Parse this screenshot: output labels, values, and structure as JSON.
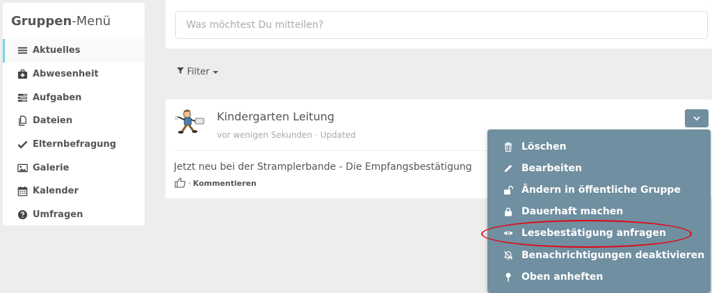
{
  "sidebar": {
    "title_bold": "Gruppen",
    "title_rest": "-Menü",
    "items": [
      {
        "label": "Aktuelles",
        "icon": "list-icon"
      },
      {
        "label": "Abwesenheit",
        "icon": "medkit-icon"
      },
      {
        "label": "Aufgaben",
        "icon": "tasks-icon"
      },
      {
        "label": "Dateien",
        "icon": "files-icon"
      },
      {
        "label": "Elternbefragung",
        "icon": "check-icon"
      },
      {
        "label": "Galerie",
        "icon": "image-icon"
      },
      {
        "label": "Kalender",
        "icon": "calendar-icon"
      },
      {
        "label": "Umfragen",
        "icon": "question-circle-icon"
      }
    ]
  },
  "post": {
    "placeholder": "Was möchtest Du mitteilen?"
  },
  "filter": {
    "label": "Filter"
  },
  "entry": {
    "author": "Kindergarten Leitung",
    "meta": "vor wenigen Sekunden · Updated",
    "text": "Jetzt neu bei der Stramplerbande - Die Empfangsbestätigung",
    "actions_separator": "·",
    "comment_label": "Kommentieren"
  },
  "dropdown": {
    "items": [
      {
        "label": "Löschen",
        "icon": "trash-icon"
      },
      {
        "label": "Bearbeiten",
        "icon": "pencil-icon"
      },
      {
        "label": "Ändern in öffentliche Gruppe",
        "icon": "unlock-icon"
      },
      {
        "label": "Dauerhaft machen",
        "icon": "lock-icon"
      },
      {
        "label": "Lesebestätigung anfragen",
        "icon": "eye-icon"
      },
      {
        "label": "Benachrichtigungen deaktivieren",
        "icon": "bell-slash-icon"
      },
      {
        "label": "Oben anheften",
        "icon": "pin-icon"
      }
    ]
  },
  "colors": {
    "accent": "#6fdbe8",
    "dropdown_bg": "#708fa0",
    "highlight": "#e30613",
    "background": "#ededed"
  }
}
